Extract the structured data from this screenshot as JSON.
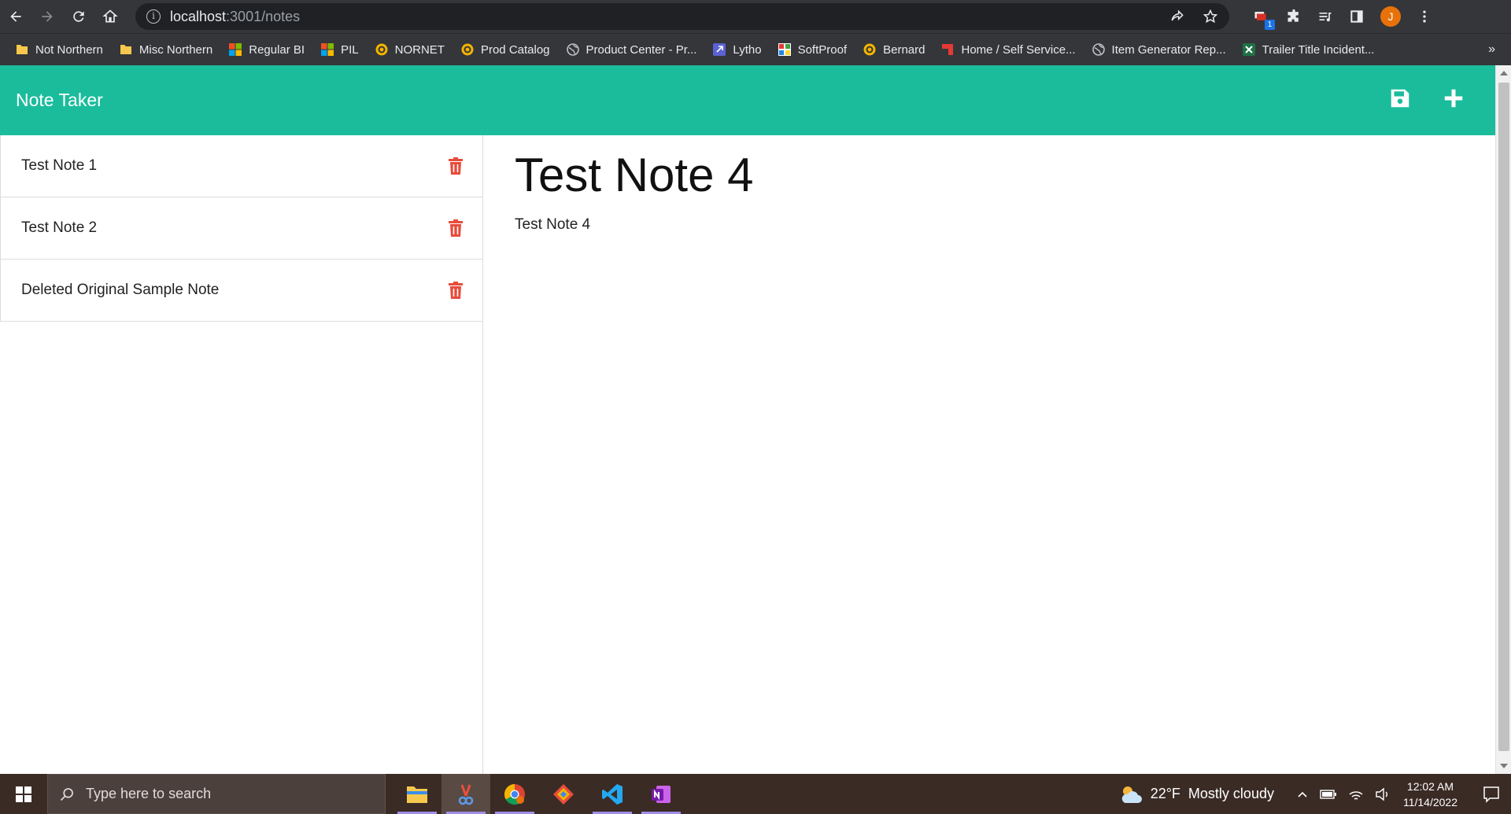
{
  "browser": {
    "url_host": "localhost",
    "url_path": ":3001/notes",
    "profile_initial": "J",
    "extension_badge": "1",
    "bookmarks": [
      {
        "label": "Not Northern",
        "icon": "folder-icon"
      },
      {
        "label": "Misc Northern",
        "icon": "folder-icon"
      },
      {
        "label": "Regular BI",
        "icon": "microsoft-logo-icon"
      },
      {
        "label": "PIL",
        "icon": "microsoft-logo-icon"
      },
      {
        "label": "NORNET",
        "icon": "site-globe-icon"
      },
      {
        "label": "Prod Catalog",
        "icon": "site-globe-icon"
      },
      {
        "label": "Product Center - Pr...",
        "icon": "globe-icon"
      },
      {
        "label": "Lytho",
        "icon": "lytho-icon"
      },
      {
        "label": "SoftProof",
        "icon": "softproof-icon"
      },
      {
        "label": "Bernard",
        "icon": "site-globe-icon"
      },
      {
        "label": "Home / Self Service...",
        "icon": "red-flag-icon"
      },
      {
        "label": "Item Generator Rep...",
        "icon": "globe-icon"
      },
      {
        "label": "Trailer Title Incident...",
        "icon": "excel-icon"
      }
    ],
    "bookmarks_more": "»"
  },
  "app": {
    "title": "Note Taker",
    "accent_color": "#1abc9c",
    "delete_color": "#e74c3c",
    "notes": [
      {
        "title": "Test Note 1"
      },
      {
        "title": "Test Note 2"
      },
      {
        "title": "Deleted Original Sample Note"
      }
    ],
    "active_note": {
      "title": "Test Note 4",
      "text": "Test Note 4"
    }
  },
  "taskbar": {
    "search_placeholder": "Type here to search",
    "weather_temp": "22°F",
    "weather_desc": "Mostly cloudy",
    "time": "12:02 AM",
    "date": "11/14/2022"
  }
}
